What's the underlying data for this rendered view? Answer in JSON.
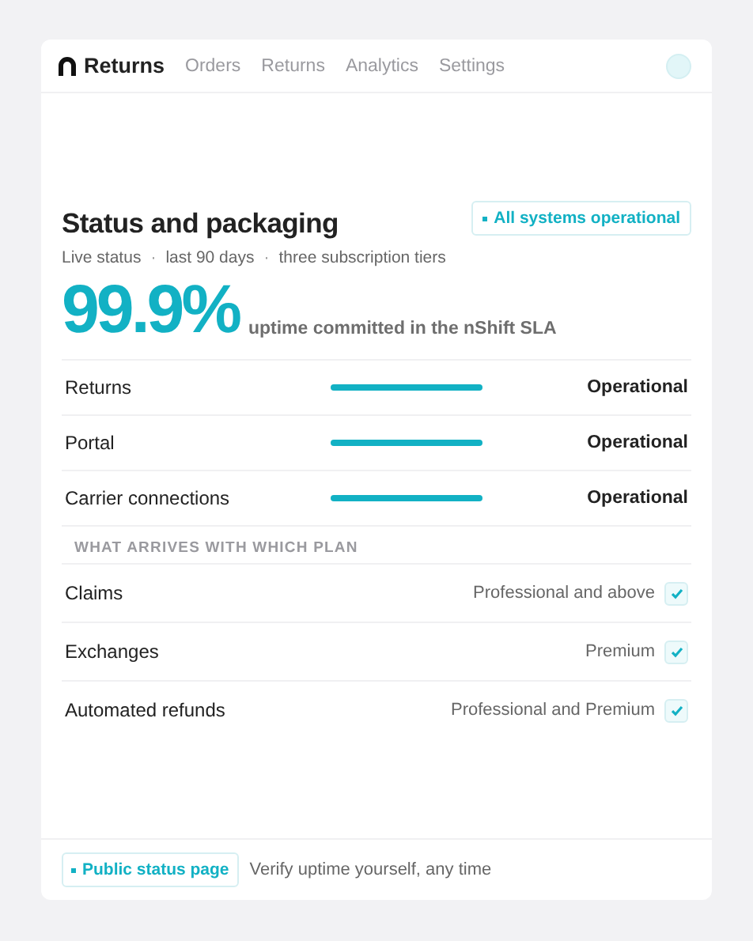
{
  "nav": {
    "brand": "Returns",
    "links": [
      "Orders",
      "Returns",
      "Analytics",
      "Settings"
    ]
  },
  "header": {
    "title": "Status and packaging",
    "badge": "All systems operational",
    "subtitle_parts": [
      "Live status",
      "·",
      "last 90 days",
      "·",
      "three subscription tiers"
    ]
  },
  "uptime": {
    "value": "99.9%",
    "caption": "uptime committed in the nShift SLA"
  },
  "services": [
    {
      "name": "Returns",
      "status": "Operational"
    },
    {
      "name": "Portal",
      "status": "Operational"
    },
    {
      "name": "Carrier connections",
      "status": "Operational"
    }
  ],
  "plans": {
    "heading": "WHAT ARRIVES WITH WHICH PLAN",
    "items": [
      {
        "name": "Claims",
        "tier": "Professional and above",
        "checked": true
      },
      {
        "name": "Exchanges",
        "tier": "Premium",
        "checked": true
      },
      {
        "name": "Automated refunds",
        "tier": "Professional and Premium",
        "checked": true
      }
    ]
  },
  "footer": {
    "link": "Public status page",
    "note": "Verify uptime yourself, any time"
  }
}
